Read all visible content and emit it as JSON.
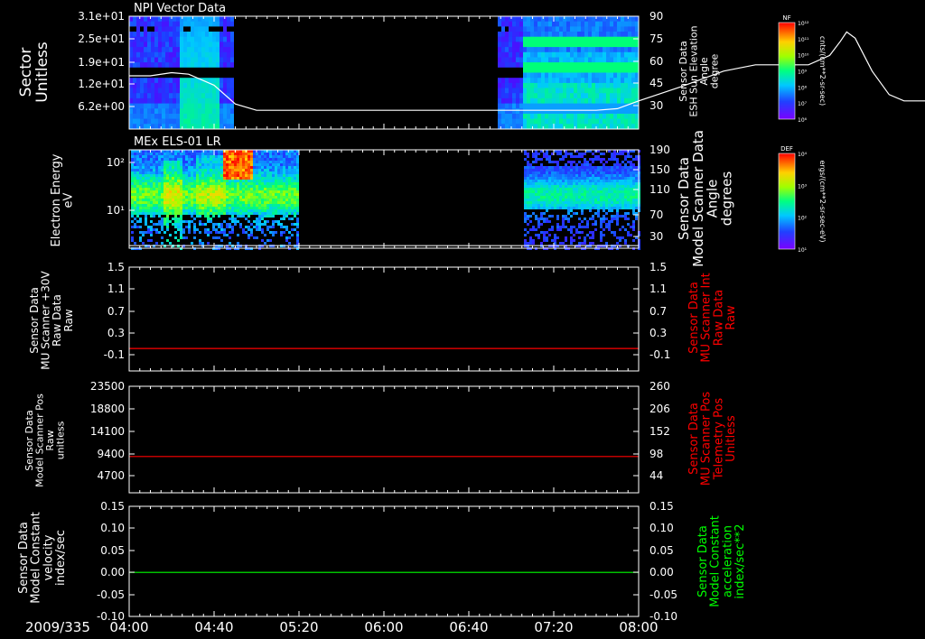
{
  "chart_data": {
    "type": "spectrogram-stack",
    "date_label": "2009/335",
    "time_ticks": [
      "04:00",
      "04:40",
      "05:20",
      "06:00",
      "06:40",
      "07:20",
      "08:00"
    ],
    "time_range": [
      "04:00",
      "08:00"
    ],
    "panels": [
      {
        "id": "npi",
        "kind": "spectrogram",
        "title": "NPI Vector Data",
        "ylabel": [
          "Sector",
          "Unitless"
        ],
        "yticks": [
          "3.1e+01",
          "2.5e+01",
          "1.9e+01",
          "1.2e+01",
          "6.2e+00"
        ],
        "right_ylabel": [
          "Sensor Data",
          "ESH Sun Elevation",
          "Angle",
          "degree"
        ],
        "right_yticks": [
          "90",
          "75",
          "60",
          "45",
          "30"
        ],
        "right_ylim": [
          18,
          90
        ],
        "data_gaps": [
          [
            "04:48",
            "06:52"
          ]
        ],
        "overlay": {
          "color": "#ffffff",
          "points": [
            [
              240,
              52
            ],
            [
              250,
              52
            ],
            [
              260,
              54
            ],
            [
              268,
              53
            ],
            [
              280,
              46
            ],
            [
              290,
              34
            ],
            [
              300,
              30
            ],
            [
              320,
              30
            ],
            [
              400,
              30
            ],
            [
              460,
              30
            ],
            [
              470,
              31
            ],
            [
              480,
              36
            ],
            [
              500,
              45
            ],
            [
              520,
              55
            ],
            [
              535,
              59
            ],
            [
              560,
              59
            ],
            [
              570,
              65
            ],
            [
              575,
              74
            ],
            [
              578,
              80
            ],
            [
              582,
              76
            ],
            [
              590,
              55
            ],
            [
              598,
              40
            ],
            [
              605,
              36
            ],
            [
              650,
              36
            ],
            [
              690,
              36
            ],
            [
              700,
              45
            ],
            [
              710,
              70
            ],
            [
              718,
              82
            ]
          ]
        },
        "colorbar": {
          "title": "NF",
          "unit": "cnts/(cm**2-sr-sec)",
          "ticks": [
            "10¹²",
            "10¹¹",
            "10¹⁰",
            "10⁹",
            "10⁸",
            "10⁷",
            "10⁶"
          ]
        }
      },
      {
        "id": "els",
        "kind": "spectrogram",
        "title": "MEx ELS-01 LR",
        "ylabel": [
          "Electron Energy",
          "eV"
        ],
        "yticks": [
          "10²",
          "10¹"
        ],
        "right_ylabel": [
          "Sensor Data",
          "Model Scanner Data",
          "Angle",
          "degrees"
        ],
        "right_yticks": [
          "190",
          "150",
          "110",
          "70",
          "30"
        ],
        "right_ylim": [
          0,
          190
        ],
        "data_gaps": [
          [
            "05:20",
            "07:05"
          ]
        ],
        "overlay": {
          "color": "#ffffff",
          "points": [
            [
              240,
              5
            ],
            [
              1200,
              5
            ]
          ]
        },
        "colorbar": {
          "title": "DEF",
          "unit": "ergs/(cm**2-sr-sec-eV)",
          "ticks": [
            "10⁴",
            "10³",
            "10²",
            "10¹"
          ]
        }
      },
      {
        "id": "mu-int",
        "kind": "line",
        "ylabel": [
          "Sensor Data",
          "MU Scanner +30V",
          "Raw Data",
          "Raw"
        ],
        "yticks": [
          "1.5",
          "1.1",
          "0.7",
          "0.3",
          "-0.1"
        ],
        "ylim": [
          -0.3,
          1.5
        ],
        "right_ylabel": [
          "Sensor Data",
          "MU Scanner Int",
          "Raw Data",
          "Raw"
        ],
        "right_yticks": [
          "1.5",
          "1.1",
          "0.7",
          "0.3",
          "-0.1"
        ],
        "right_label_color": "#ff0000",
        "series": [
          {
            "color": "#ff0000",
            "values": [
              0.09,
              0.09
            ]
          }
        ]
      },
      {
        "id": "mu-pos",
        "kind": "line",
        "ylabel": [
          "Sensor Data",
          "Model Scanner Pos",
          "Raw",
          "unitless"
        ],
        "yticks": [
          "23500",
          "18800",
          "14100",
          "9400",
          "4700"
        ],
        "ylim": [
          0,
          23500
        ],
        "right_ylabel": [
          "Sensor Data",
          "MU Scanner Pos",
          "Telemetry Pos",
          "Unitless"
        ],
        "right_yticks": [
          "260",
          "206",
          "152",
          "98",
          "44"
        ],
        "right_label_color": "#ff0000",
        "series": [
          {
            "color": "#ff0000",
            "values": [
              8000,
              8000
            ]
          }
        ]
      },
      {
        "id": "velocity",
        "kind": "line",
        "ylabel": [
          "Sensor Data",
          "Model Constant",
          "velocity",
          "index/sec"
        ],
        "yticks": [
          "0.15",
          "0.10",
          "0.05",
          "0.00",
          "-0.05",
          "-0.10"
        ],
        "ylim": [
          -0.1,
          0.15
        ],
        "right_ylabel": [
          "Sensor Data",
          "Model Constant",
          "acceleration",
          "index/sec**2"
        ],
        "right_yticks": [
          "0.15",
          "0.10",
          "0.05",
          "0.00",
          "-0.05",
          "-0.10"
        ],
        "right_label_color": "#00ff00",
        "series": [
          {
            "color": "#00ff00",
            "values": [
              0.0,
              0.0
            ]
          }
        ]
      }
    ]
  }
}
